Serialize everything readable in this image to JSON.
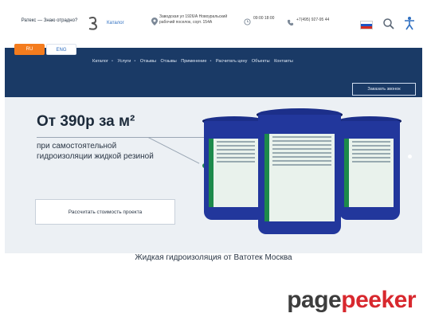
{
  "header": {
    "brand_text": "Ратекс — Знаю отрадно?",
    "catalog_link": "Каталог",
    "address": "Заводская ул 1926/А Новоуральский рабочий поселок, сорт. 154А",
    "hours": "09:00 18:00",
    "phone": "+7(495) 927-95 44",
    "icons": [
      "logo-icon",
      "map-pin-icon",
      "clock-icon",
      "phone-icon",
      "flag-ru-icon",
      "search-icon",
      "accessibility-icon"
    ]
  },
  "lang": {
    "ru": "RU",
    "en": "ENG"
  },
  "nav": {
    "items": [
      "Каталог",
      "Услуги",
      "Отзывы",
      "Отзывы",
      "Применение",
      "Расчитать цену",
      "Объекты",
      "Контакты"
    ],
    "separator": "•",
    "callback": "Заказать звонок"
  },
  "hero": {
    "title": "От 390р за м²",
    "subtitle": "при самостоятельной гидроизоляции жидкой резиной",
    "calc_button": "Рассчитать стоимость проекта"
  },
  "bottom_text": "Жидкая гидроизоляция от Ватотек Москва",
  "watermark": {
    "part1": "page",
    "part2": "peeker"
  },
  "colors": {
    "nav_bg": "#1a3a66",
    "accent_orange": "#f47c1e",
    "accent_green": "#1f8a52",
    "bucket_blue": "#22379c",
    "watermark_red": "#d8282e"
  }
}
